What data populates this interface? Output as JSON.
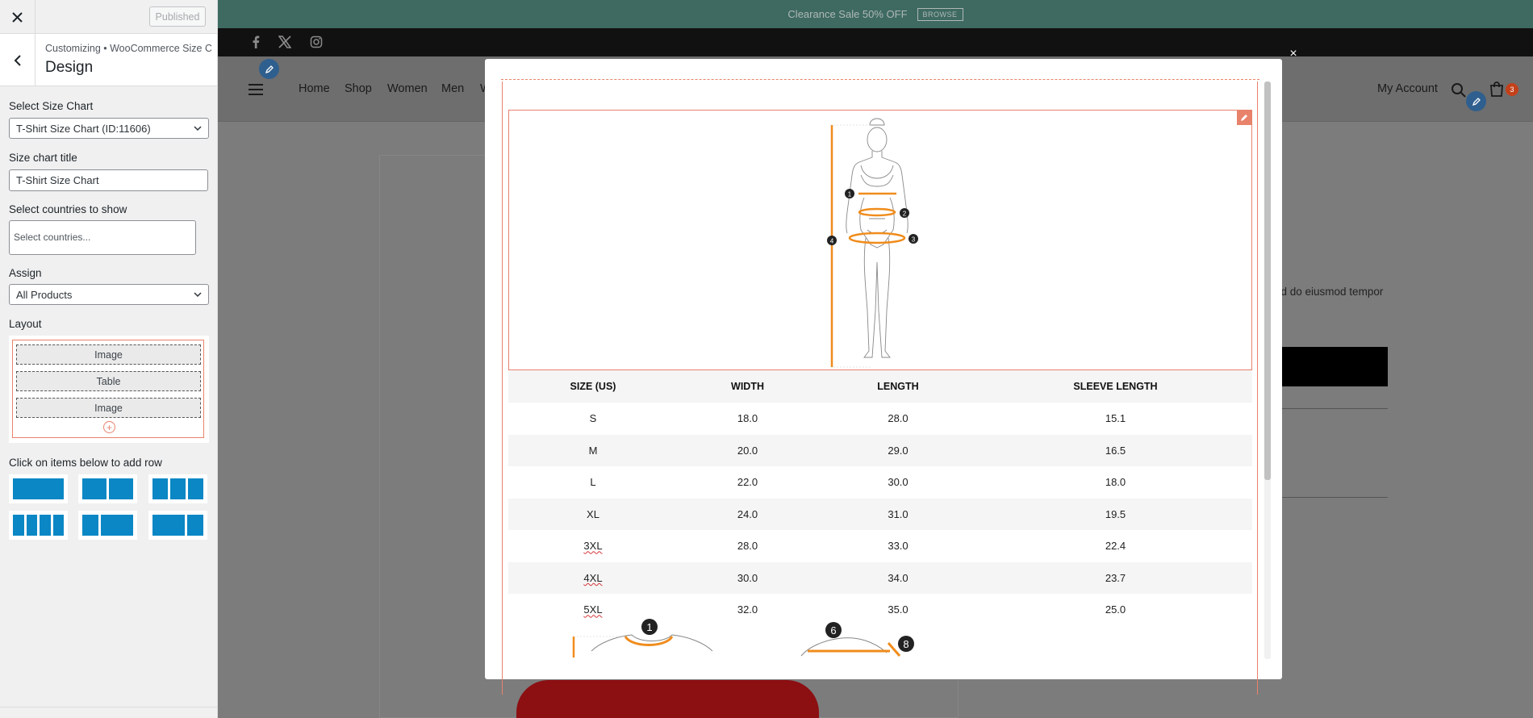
{
  "customizer": {
    "published_label": "Published",
    "breadcrumb": "Customizing  •  WooCommerce Size C...",
    "section_title": "Design",
    "select_size_chart": {
      "label": "Select Size Chart",
      "value": "T-Shirt Size Chart (ID:11606)"
    },
    "size_chart_title": {
      "label": "Size chart title",
      "value": "T-Shirt Size Chart"
    },
    "countries": {
      "label": "Select countries to show",
      "placeholder": "Select countries..."
    },
    "assign": {
      "label": "Assign",
      "value": "All Products"
    },
    "layout": {
      "label": "Layout",
      "items": [
        "Image",
        "Table",
        "Image"
      ],
      "add_symbol": "+"
    },
    "add_row_label": "Click on items below to add row"
  },
  "site": {
    "promo_text": "Clearance Sale 50% OFF",
    "promo_button": "BROWSE",
    "social_icons": [
      "facebook-icon",
      "x-twitter-icon",
      "instagram-icon"
    ],
    "nav": [
      "Home",
      "Shop",
      "Women",
      "Men",
      "W"
    ],
    "my_account": "My Account",
    "cart_count": "3",
    "product_text_fragment": "ed do eiusmod tempor"
  },
  "modal": {
    "close_symbol": "×",
    "figure_markers": [
      "1",
      "2",
      "3",
      "4"
    ],
    "bottom_markers": [
      "1",
      "6",
      "8"
    ],
    "table": {
      "headers": [
        "SIZE (US)",
        "WIDTH",
        "LENGTH",
        "SLEEVE LENGTH"
      ],
      "rows": [
        [
          "S",
          "18.0",
          "28.0",
          "15.1"
        ],
        [
          "M",
          "20.0",
          "29.0",
          "16.5"
        ],
        [
          "L",
          "22.0",
          "30.0",
          "18.0"
        ],
        [
          "XL",
          "24.0",
          "31.0",
          "19.5"
        ],
        [
          "3XL",
          "28.0",
          "33.0",
          "22.4"
        ],
        [
          "4XL",
          "30.0",
          "34.0",
          "23.7"
        ],
        [
          "5XL",
          "32.0",
          "35.0",
          "25.0"
        ]
      ]
    }
  },
  "colors": {
    "accent": "#e8826b",
    "measure_orange": "#f08c1c",
    "wp_blue": "#0a87c4",
    "promo_bg": "#3e6a62"
  }
}
